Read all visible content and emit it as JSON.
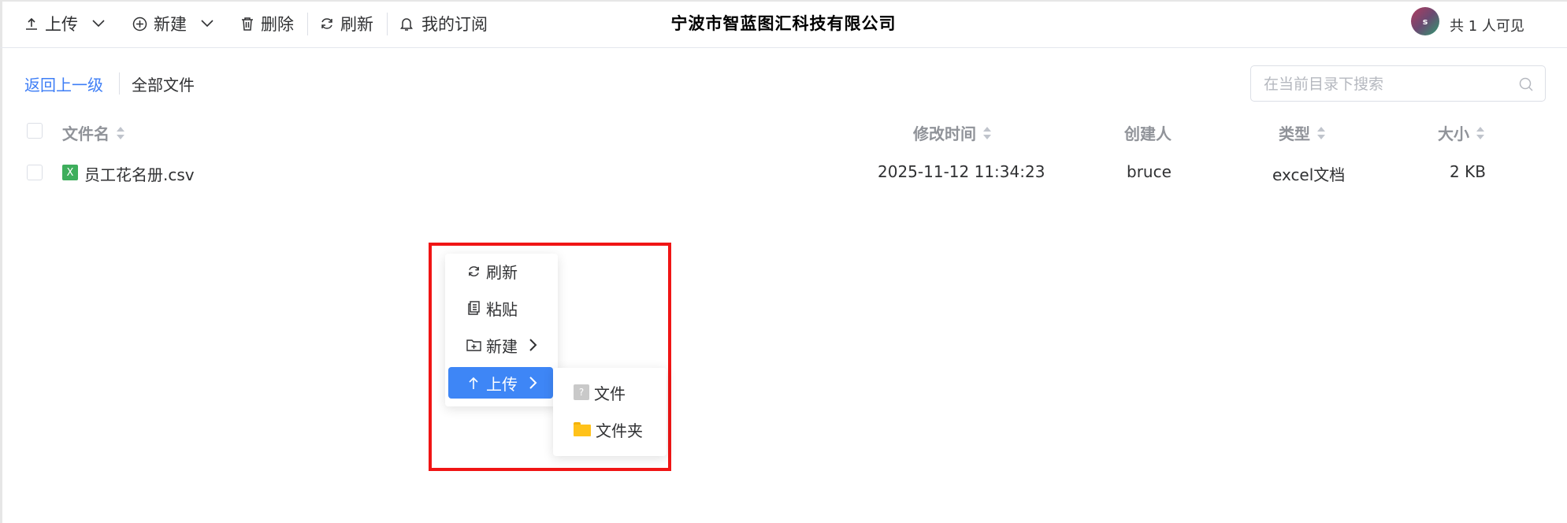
{
  "toolbar": {
    "upload_label": "上传",
    "new_label": "新建",
    "delete_label": "删除",
    "refresh_label": "刷新",
    "subscribe_label": "我的订阅",
    "company": "宁波市智蓝图汇科技有限公司",
    "avatar_initial": "s",
    "visibility": "共 1 人可见"
  },
  "breadcrumb": {
    "back": "返回上一级",
    "current": "全部文件"
  },
  "search": {
    "placeholder": "在当前目录下搜索"
  },
  "table": {
    "headers": {
      "name": "文件名",
      "modified": "修改时间",
      "creator": "创建人",
      "type": "类型",
      "size": "大小"
    },
    "rows": [
      {
        "name": "员工花名册.csv",
        "modified": "2025-11-12 11:34:23",
        "creator": "bruce",
        "type": "excel文档",
        "size": "2 KB",
        "icon": "excel-icon",
        "icon_letter": "X"
      }
    ]
  },
  "context_menu": {
    "items": [
      {
        "label": "刷新",
        "icon": "refresh-icon"
      },
      {
        "label": "粘贴",
        "icon": "paste-icon"
      },
      {
        "label": "新建",
        "icon": "new-folder-icon"
      },
      {
        "label": "上传",
        "icon": "arrow-up-icon",
        "active": true
      }
    ],
    "submenu": [
      {
        "label": "文件",
        "icon": "unknown-file-icon",
        "icon_glyph": "?"
      },
      {
        "label": "文件夹",
        "icon": "folder-icon"
      }
    ]
  },
  "colors": {
    "accent": "#3e86f6",
    "link": "#3e7ef6",
    "highlight_border": "#f01515",
    "excel_green": "#3eae5c",
    "folder_yellow": "#ffc21a"
  }
}
